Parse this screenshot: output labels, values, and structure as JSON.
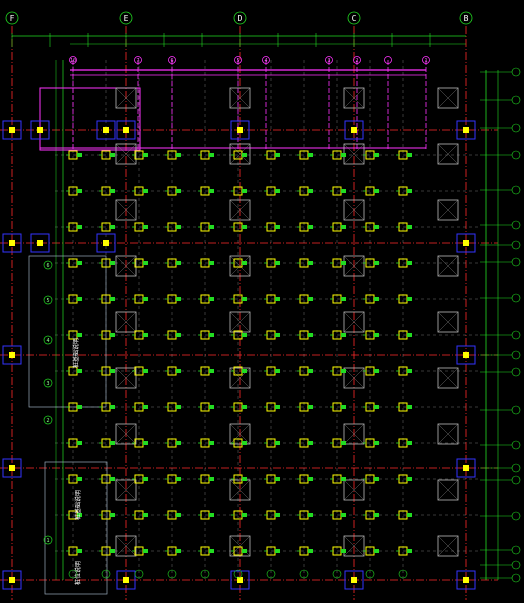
{
  "drawing": {
    "column_axes_top": [
      "F",
      "E",
      "D",
      "C",
      "B"
    ],
    "pink_axes_top": [
      "10",
      "7",
      "6",
      "5",
      "4",
      "3",
      "2",
      "1"
    ],
    "left_axes": [
      "6",
      "5",
      "4",
      "3",
      "2",
      "1"
    ],
    "notes": [
      "桩基础说明",
      "桩基础说明",
      "桩位说明"
    ],
    "colors": {
      "background": "#000000",
      "axis_red": "#ff2a2a",
      "axis_green": "#22dd22",
      "magenta": "#ff33ff",
      "yellow": "#ffff00",
      "blue": "#3333ff",
      "white": "#ffffff",
      "gray": "#cccccc"
    }
  }
}
